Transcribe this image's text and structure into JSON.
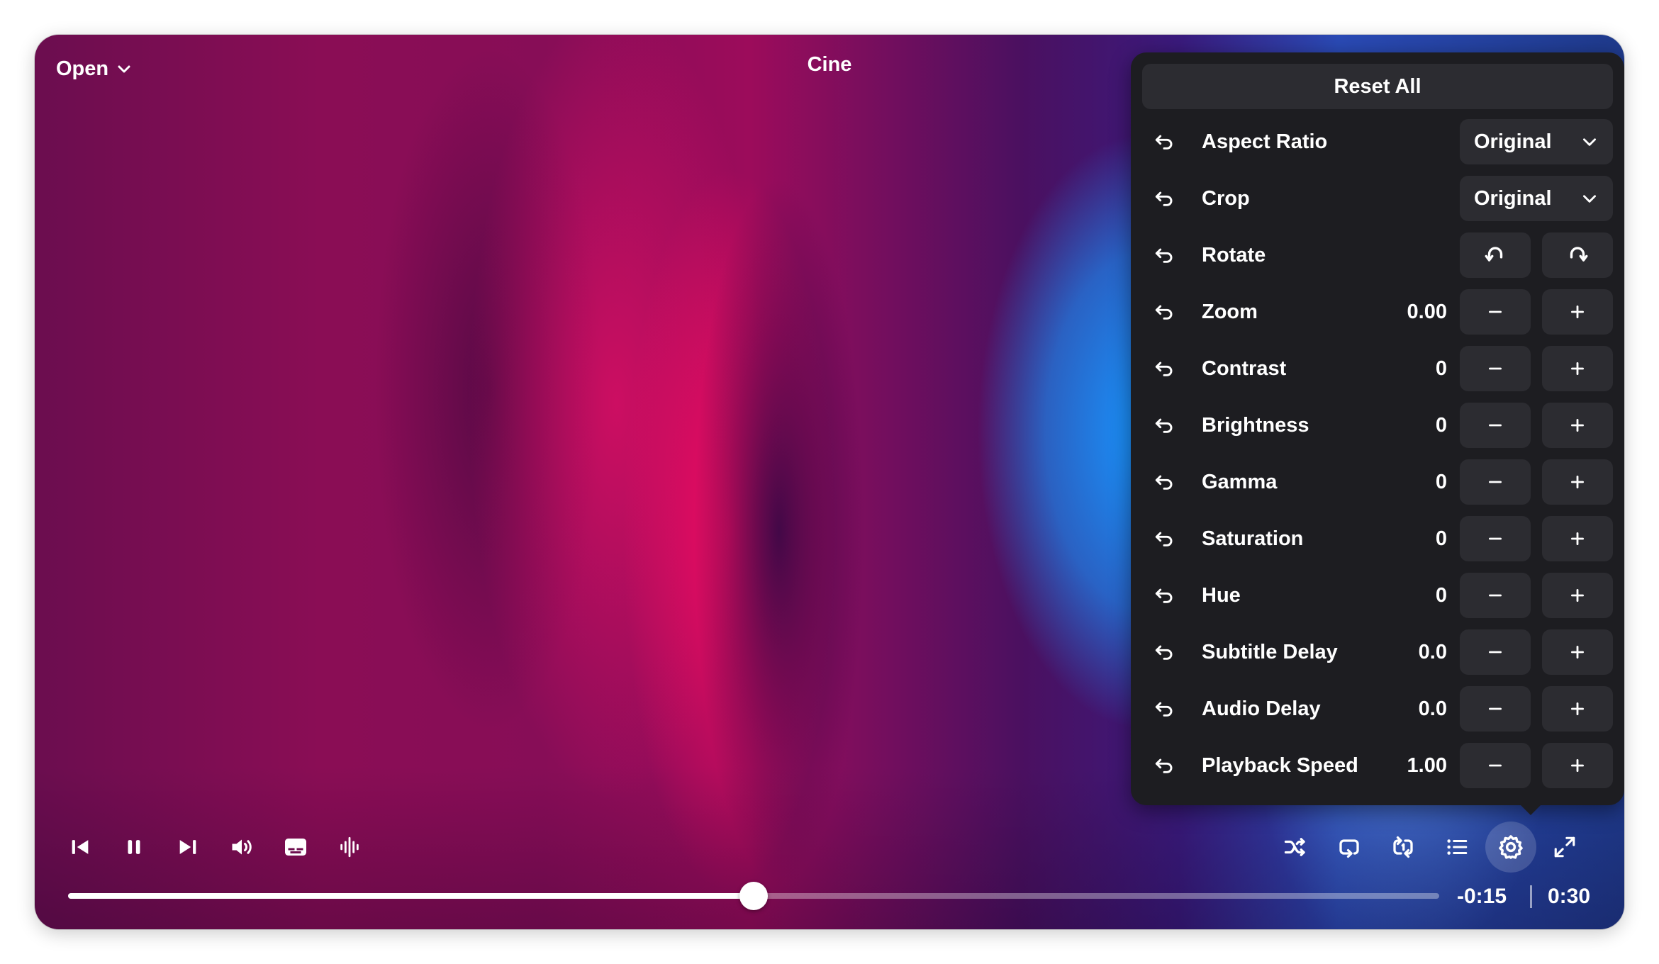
{
  "window": {
    "title": "Cine"
  },
  "topbar": {
    "open_label": "Open"
  },
  "panel": {
    "reset_all_label": "Reset All",
    "aspect_ratio": {
      "label": "Aspect Ratio",
      "value": "Original"
    },
    "crop": {
      "label": "Crop",
      "value": "Original"
    },
    "rotate": {
      "label": "Rotate"
    },
    "rows": [
      {
        "label": "Zoom",
        "value": "0.00"
      },
      {
        "label": "Contrast",
        "value": "0"
      },
      {
        "label": "Brightness",
        "value": "0"
      },
      {
        "label": "Gamma",
        "value": "0"
      },
      {
        "label": "Saturation",
        "value": "0"
      },
      {
        "label": "Hue",
        "value": "0"
      },
      {
        "label": "Subtitle Delay",
        "value": "0.0"
      },
      {
        "label": "Audio Delay",
        "value": "0.0"
      },
      {
        "label": "Playback Speed",
        "value": "1.00"
      }
    ]
  },
  "playback": {
    "progress": 0.5,
    "remaining": "-0:15",
    "duration": "0:30"
  },
  "icons": {
    "left": [
      "skip-previous-icon",
      "pause-icon",
      "skip-next-icon",
      "volume-icon",
      "subtitles-icon",
      "audio-track-icon"
    ],
    "right": [
      "shuffle-icon",
      "repeat-icon",
      "repeat-one-icon",
      "playlist-icon",
      "settings-icon",
      "fullscreen-icon"
    ],
    "active": "settings-icon"
  }
}
